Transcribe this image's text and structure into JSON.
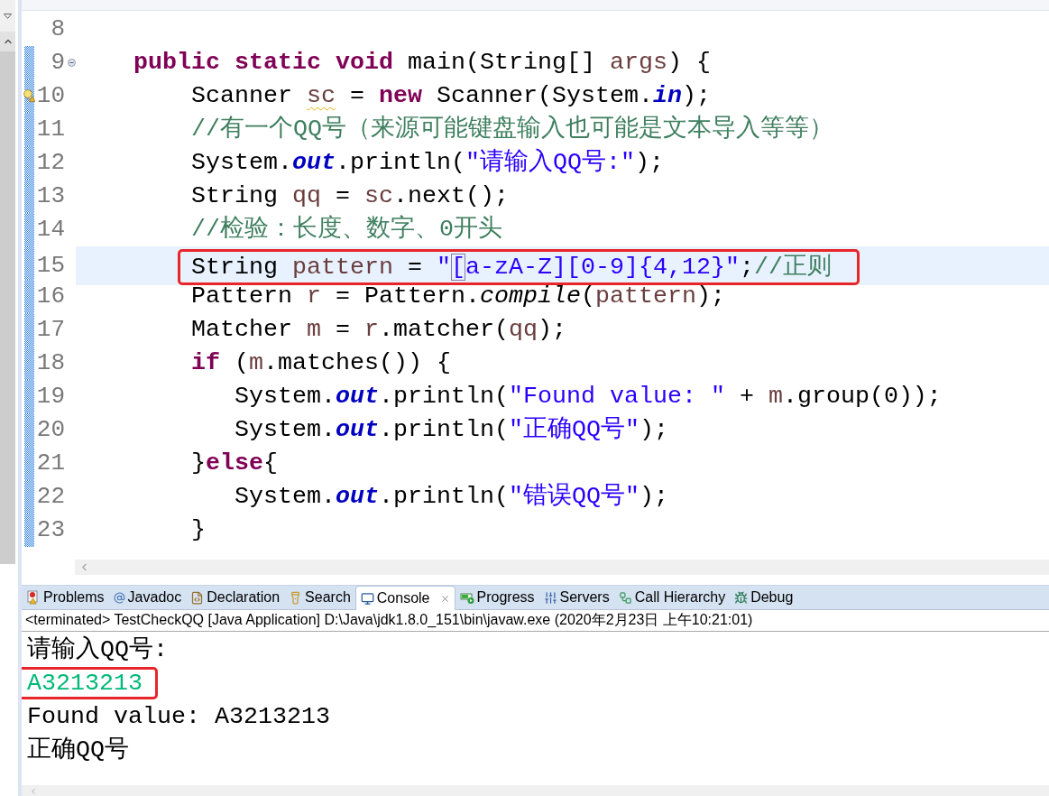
{
  "editor": {
    "lines": [
      {
        "number": "8",
        "changed": false,
        "current": false,
        "boxed": false,
        "warning": false
      },
      {
        "number": "9",
        "changed": true,
        "current": false,
        "boxed": false,
        "warning": false,
        "folded": false,
        "tokens": [
          {
            "kind": "kw",
            "text": "public static void"
          },
          {
            "kind": "plain",
            "text": " main(String[] "
          },
          {
            "kind": "local",
            "text": "args"
          },
          {
            "kind": "plain",
            "text": ") {"
          }
        ],
        "children": [
          {
            "number": "10",
            "changed": true,
            "current": false,
            "boxed": false,
            "warning": true,
            "tokens": [
              {
                "kind": "plain",
                "text": "Scanner "
              },
              {
                "kind": "local-warn",
                "text": "sc"
              },
              {
                "kind": "plain",
                "text": " = "
              },
              {
                "kind": "kw",
                "text": "new"
              },
              {
                "kind": "plain",
                "text": " Scanner(System."
              },
              {
                "kind": "field",
                "text": "in"
              },
              {
                "kind": "plain",
                "text": ");"
              }
            ]
          },
          {
            "number": "11",
            "changed": true,
            "current": false,
            "boxed": false,
            "warning": false,
            "tokens": [
              {
                "kind": "comment",
                "text": "//有一个QQ号（来源可能键盘输入也可能是文本导入等等）"
              }
            ]
          },
          {
            "number": "12",
            "changed": true,
            "current": false,
            "boxed": false,
            "warning": false,
            "tokens": [
              {
                "kind": "plain",
                "text": "System."
              },
              {
                "kind": "field",
                "text": "out"
              },
              {
                "kind": "plain",
                "text": ".println("
              },
              {
                "kind": "str",
                "text": "\"请输入QQ号:\""
              },
              {
                "kind": "plain",
                "text": ");"
              }
            ]
          },
          {
            "number": "13",
            "changed": true,
            "current": false,
            "boxed": false,
            "warning": false,
            "tokens": [
              {
                "kind": "plain",
                "text": "String "
              },
              {
                "kind": "local",
                "text": "qq"
              },
              {
                "kind": "plain",
                "text": " = "
              },
              {
                "kind": "local",
                "text": "sc"
              },
              {
                "kind": "plain",
                "text": ".next();"
              }
            ]
          },
          {
            "number": "14",
            "changed": true,
            "current": false,
            "boxed": false,
            "warning": false,
            "tokens": [
              {
                "kind": "comment",
                "text": "//检验：长度、数字、0开头"
              }
            ]
          },
          {
            "number": "15",
            "changed": true,
            "current": true,
            "boxed": true,
            "warning": false,
            "tokens": [
              {
                "kind": "plain",
                "text": "String "
              },
              {
                "kind": "local",
                "text": "pattern"
              },
              {
                "kind": "plain",
                "text": " = "
              },
              {
                "kind": "str",
                "text": "\""
              },
              {
                "kind": "bracket",
                "text": "["
              },
              {
                "kind": "str",
                "text": "a-zA-Z][0-9]{4,12}\""
              },
              {
                "kind": "plain",
                "text": ";"
              },
              {
                "kind": "comment",
                "text": "//正则"
              }
            ]
          },
          {
            "number": "16",
            "changed": true,
            "current": false,
            "boxed": false,
            "warning": false,
            "tokens": [
              {
                "kind": "plain",
                "text": "Pattern "
              },
              {
                "kind": "local",
                "text": "r"
              },
              {
                "kind": "plain",
                "text": " = Pattern."
              },
              {
                "kind": "static",
                "text": "compile"
              },
              {
                "kind": "plain",
                "text": "("
              },
              {
                "kind": "local",
                "text": "pattern"
              },
              {
                "kind": "plain",
                "text": ");"
              }
            ]
          },
          {
            "number": "17",
            "changed": true,
            "current": false,
            "boxed": false,
            "warning": false,
            "tokens": [
              {
                "kind": "plain",
                "text": "Matcher "
              },
              {
                "kind": "local",
                "text": "m"
              },
              {
                "kind": "plain",
                "text": " = "
              },
              {
                "kind": "local",
                "text": "r"
              },
              {
                "kind": "plain",
                "text": ".matcher("
              },
              {
                "kind": "local",
                "text": "qq"
              },
              {
                "kind": "plain",
                "text": ");"
              }
            ]
          },
          {
            "number": "18",
            "changed": true,
            "current": false,
            "boxed": false,
            "warning": false,
            "tokens": [
              {
                "kind": "kw",
                "text": "if"
              },
              {
                "kind": "plain",
                "text": " ("
              },
              {
                "kind": "local",
                "text": "m"
              },
              {
                "kind": "plain",
                "text": ".matches()) {"
              }
            ],
            "children": [
              {
                "number": "19",
                "changed": true,
                "current": false,
                "boxed": false,
                "warning": false,
                "tokens": [
                  {
                    "kind": "plain",
                    "text": "System."
                  },
                  {
                    "kind": "field",
                    "text": "out"
                  },
                  {
                    "kind": "plain",
                    "text": ".println("
                  },
                  {
                    "kind": "str",
                    "text": "\"Found value: \""
                  },
                  {
                    "kind": "plain",
                    "text": " + "
                  },
                  {
                    "kind": "local",
                    "text": "m"
                  },
                  {
                    "kind": "plain",
                    "text": ".group(0));"
                  }
                ]
              },
              {
                "number": "20",
                "changed": true,
                "current": false,
                "boxed": false,
                "warning": false,
                "tokens": [
                  {
                    "kind": "plain",
                    "text": "System."
                  },
                  {
                    "kind": "field",
                    "text": "out"
                  },
                  {
                    "kind": "plain",
                    "text": ".println("
                  },
                  {
                    "kind": "str",
                    "text": "\"正确QQ号\""
                  },
                  {
                    "kind": "plain",
                    "text": ");"
                  }
                ]
              }
            ]
          },
          {
            "number": "21",
            "changed": true,
            "current": false,
            "boxed": false,
            "warning": false,
            "tokens": [
              {
                "kind": "plain",
                "text": "}"
              },
              {
                "kind": "kw",
                "text": "else"
              },
              {
                "kind": "plain",
                "text": "{"
              }
            ],
            "children": [
              {
                "number": "22",
                "changed": true,
                "current": false,
                "boxed": false,
                "warning": false,
                "tokens": [
                  {
                    "kind": "plain",
                    "text": "System."
                  },
                  {
                    "kind": "field",
                    "text": "out"
                  },
                  {
                    "kind": "plain",
                    "text": ".println("
                  },
                  {
                    "kind": "str",
                    "text": "\"错误QQ号\""
                  },
                  {
                    "kind": "plain",
                    "text": ");"
                  }
                ]
              }
            ]
          },
          {
            "number": "23",
            "changed": true,
            "current": false,
            "boxed": false,
            "warning": false,
            "tokens": [
              {
                "kind": "plain",
                "text": "}"
              }
            ]
          }
        ]
      }
    ]
  },
  "views": {
    "tabs": [
      {
        "kind": "problems",
        "label": "Problems",
        "selected": false
      },
      {
        "kind": "javadoc",
        "label": "Javadoc",
        "selected": false
      },
      {
        "kind": "declaration",
        "label": "Declaration",
        "selected": false
      },
      {
        "kind": "search",
        "label": "Search",
        "selected": false
      },
      {
        "kind": "console",
        "label": "Console",
        "selected": true
      },
      {
        "kind": "progress",
        "label": "Progress",
        "selected": false
      },
      {
        "kind": "servers",
        "label": "Servers",
        "selected": false
      },
      {
        "kind": "hierarchy",
        "label": "Call Hierarchy",
        "selected": false
      },
      {
        "kind": "debug",
        "label": "Debug",
        "selected": false
      }
    ]
  },
  "console": {
    "header": "<terminated> TestCheckQQ [Java Application] D:\\Java\\jdk1.8.0_151\\bin\\javaw.exe (2020年2月23日 上午10:21:01)",
    "lines": [
      {
        "kind": "stdout",
        "text": "请输入QQ号:",
        "boxed": false
      },
      {
        "kind": "stdin",
        "text": "A3213213",
        "boxed": true
      },
      {
        "kind": "stdout",
        "text": "Found value: A3213213",
        "boxed": false
      },
      {
        "kind": "stdout",
        "text": "正确QQ号",
        "boxed": false
      }
    ]
  }
}
